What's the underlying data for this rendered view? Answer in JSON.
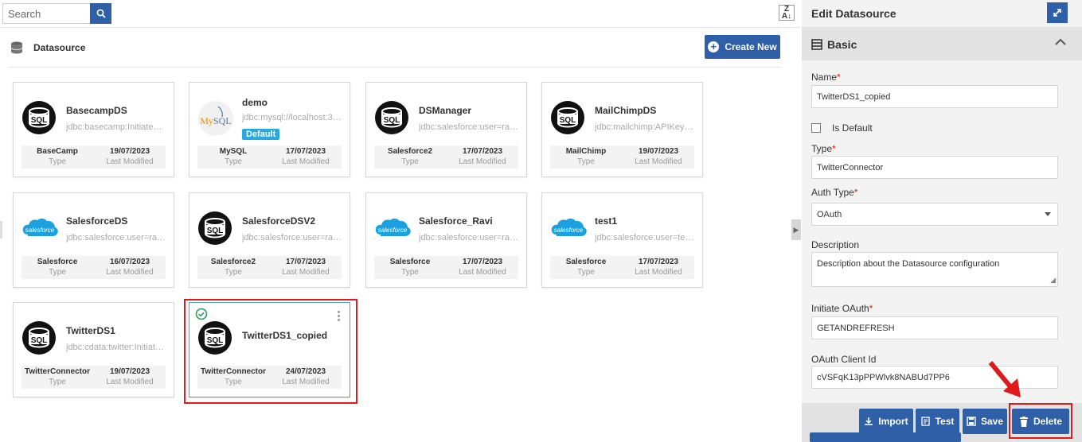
{
  "search": {
    "placeholder": "Search"
  },
  "header": {
    "title": "Datasource",
    "create_label": "Create New"
  },
  "cards": [
    {
      "name": "BasecampDS",
      "connection": "jdbc:basecamp:InitiateOAuth=...",
      "type": "BaseCamp",
      "date": "19/07/2023",
      "type_label": "Type",
      "date_label": "Last Modified",
      "icon": "sql-icon"
    },
    {
      "name": "demo",
      "connection": "jdbc:mysql://localhost:3306/...",
      "type": "MySQL",
      "date": "17/07/2023",
      "type_label": "Type",
      "date_label": "Last Modified",
      "icon": "mysql-icon",
      "badge": "Default",
      "logo_text": "MySQL"
    },
    {
      "name": "DSManager",
      "connection": "jdbc:salesforce:user=ravi...",
      "type": "Salesforce2",
      "date": "17/07/2023",
      "type_label": "Type",
      "date_label": "Last Modified",
      "icon": "sql-icon"
    },
    {
      "name": "MailChimpDS",
      "connection": "jdbc:mailchimp:APIKey=...",
      "type": "MailChimp",
      "date": "19/07/2023",
      "type_label": "Type",
      "date_label": "Last Modified",
      "icon": "sql-icon"
    },
    {
      "name": "SalesforceDS",
      "connection": "jdbc:salesforce:user=ravi...",
      "type": "Salesforce",
      "date": "16/07/2023",
      "type_label": "Type",
      "date_label": "Last Modified",
      "icon": "salesforce-icon",
      "logo_text": "salesforce"
    },
    {
      "name": "SalesforceDSV2",
      "connection": "jdbc:salesforce:user=ravi...",
      "type": "Salesforce2",
      "date": "17/07/2023",
      "type_label": "Type",
      "date_label": "Last Modified",
      "icon": "sql-icon"
    },
    {
      "name": "Salesforce_Ravi",
      "connection": "jdbc:salesforce:user=ravi...",
      "type": "Salesforce",
      "date": "17/07/2023",
      "type_label": "Type",
      "date_label": "Last Modified",
      "icon": "salesforce-icon",
      "logo_text": "salesforce"
    },
    {
      "name": "test1",
      "connection": "jdbc:salesforce:user=test...",
      "type": "Salesforce",
      "date": "17/07/2023",
      "type_label": "Type",
      "date_label": "Last Modified",
      "icon": "salesforce-icon",
      "logo_text": "salesforce"
    },
    {
      "name": "TwitterDS1",
      "connection": "jdbc:cdata:twitter:InitiateOAuth=...",
      "type": "TwitterConnector",
      "date": "19/07/2023",
      "type_label": "Type",
      "date_label": "Last Modified",
      "icon": "sql-icon"
    },
    {
      "name": "TwitterDS1_copied",
      "connection": "",
      "type": "TwitterConnector",
      "date": "24/07/2023",
      "type_label": "Type",
      "date_label": "Last Modified",
      "icon": "sql-icon",
      "selected": true
    }
  ],
  "edit_panel": {
    "title": "Edit Datasource",
    "section": "Basic",
    "name_label": "Name",
    "name_value": "TwitterDS1_copied",
    "is_default_label": "Is Default",
    "type_label": "Type",
    "type_value": "TwitterConnector",
    "auth_type_label": "Auth Type",
    "auth_type_value": "OAuth",
    "description_label": "Description",
    "description_value": "Description about the Datasource configuration",
    "initiate_oauth_label": "Initiate OAuth",
    "initiate_oauth_value": "GETANDREFRESH",
    "client_id_label": "OAuth Client Id",
    "client_id_value": "cVSFqK13pPPWlvk8NABUd7PP6",
    "required_mark": "*"
  },
  "actions": {
    "import": "Import",
    "test": "Test",
    "save": "Save",
    "delete": "Delete"
  },
  "colors": {
    "accent": "#2f5fa7",
    "highlight": "#e0191b",
    "badge": "#27a9e1"
  }
}
